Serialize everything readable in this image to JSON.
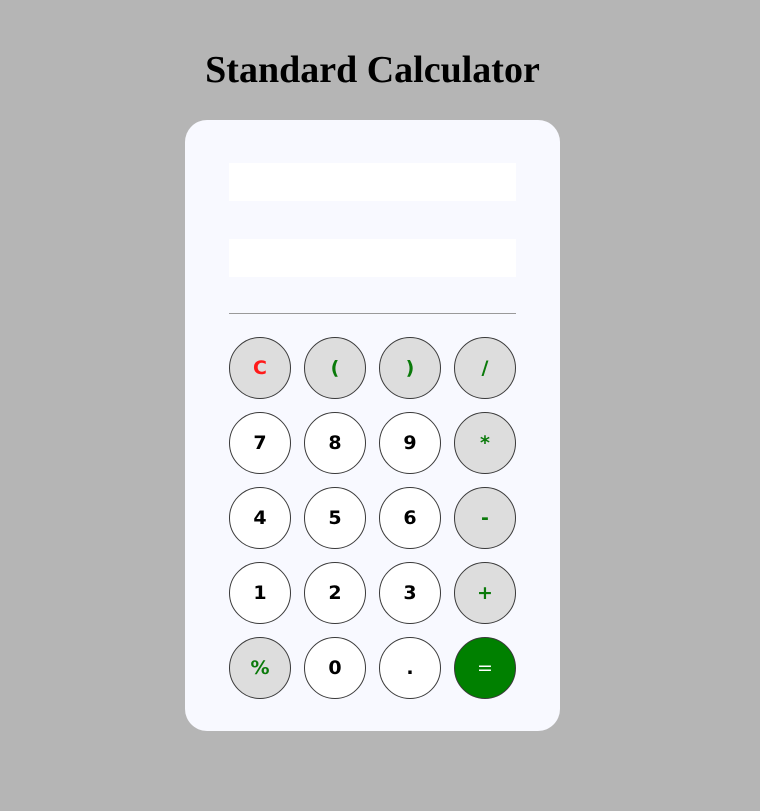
{
  "page": {
    "title": "Standard Calculator"
  },
  "display": {
    "expression_value": "",
    "result_value": ""
  },
  "keys": [
    {
      "label": "C",
      "type": "clear",
      "name": "clear-button"
    },
    {
      "label": "(",
      "type": "op",
      "name": "open-paren-button"
    },
    {
      "label": ")",
      "type": "op",
      "name": "close-paren-button"
    },
    {
      "label": "/",
      "type": "op",
      "name": "divide-button"
    },
    {
      "label": "7",
      "type": "digit",
      "name": "digit-7-button"
    },
    {
      "label": "8",
      "type": "digit",
      "name": "digit-8-button"
    },
    {
      "label": "9",
      "type": "digit",
      "name": "digit-9-button"
    },
    {
      "label": "*",
      "type": "op",
      "name": "multiply-button"
    },
    {
      "label": "4",
      "type": "digit",
      "name": "digit-4-button"
    },
    {
      "label": "5",
      "type": "digit",
      "name": "digit-5-button"
    },
    {
      "label": "6",
      "type": "digit",
      "name": "digit-6-button"
    },
    {
      "label": "-",
      "type": "op",
      "name": "subtract-button"
    },
    {
      "label": "1",
      "type": "digit",
      "name": "digit-1-button"
    },
    {
      "label": "2",
      "type": "digit",
      "name": "digit-2-button"
    },
    {
      "label": "3",
      "type": "digit",
      "name": "digit-3-button"
    },
    {
      "label": "+",
      "type": "op",
      "name": "add-button"
    },
    {
      "label": "%",
      "type": "op",
      "name": "percent-button"
    },
    {
      "label": "0",
      "type": "digit",
      "name": "digit-0-button"
    },
    {
      "label": ".",
      "type": "digit",
      "name": "decimal-point-button"
    },
    {
      "label": "=",
      "type": "equals",
      "name": "equals-button"
    }
  ],
  "colors": {
    "background": "#b5b5b5",
    "panel": "#f8f9ff",
    "operator_text": "#0a7a0a",
    "clear_text": "#ff1a1a",
    "equals_fill": "#008000",
    "operator_fill": "#dddddd"
  }
}
